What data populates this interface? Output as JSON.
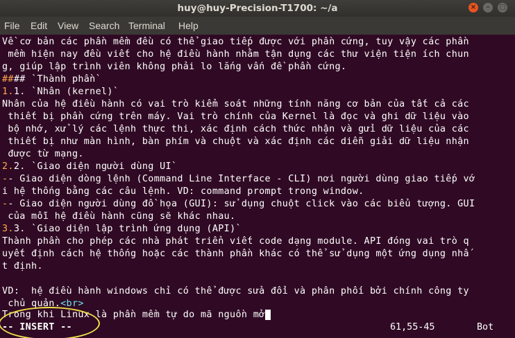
{
  "window": {
    "title": "huy@huy-Precision-T1700: ~/a",
    "close": "×",
    "minimize": "–",
    "maximize": "□"
  },
  "menu": [
    "File",
    "Edit",
    "View",
    "Search",
    "Terminal",
    "Help"
  ],
  "lines": [
    "Về cơ bản các phần mềm đều có thể giao tiếp được với phần cứng, tuy vậy các phần",
    " mềm hiện nay đều viết cho hệ điều hành nhằm tận dụng các thư viện tiện ích chun",
    "g, giúp lập trình viên không phải lo lắng vấn đề phần cứng.",
    "## `Thành phần`",
    "1. `Nhân (kernel)`",
    "Nhân của hệ điều hành có vai trò kiểm soát những tính năng cơ bản của tất cả các",
    " thiết bị phần cứng trên máy. Vai trò chính của Kernel là đọc và ghi dữ liệu vào",
    " bộ nhớ, xử lý các lệnh thực thi, xác định cách thức nhận và gửi dữ liệu của các",
    " thiết bị như màn hình, bàn phím và chuột và xác định các diễn giải dữ liệu nhận",
    " được từ mạng.",
    "2. `Giao diện người dùng UI`",
    "- Giao diện dòng lệnh (Command Line Interface - CLI) nơi người dùng giao tiếp vớ",
    "i hệ thống bằng các câu lệnh. VD: command prompt trong window.",
    "- Giao diện người dùng đồ họa (GUI): sử dụng chuột click vào các biểu tượng. GUI",
    " của mỗi hệ điều hành cũng sẽ khác nhau.",
    "3. `Giao diện lập trình ứng dụng (API)`",
    "Thành phần cho phép các nhà phát triển viết code dạng module. API đóng vai trò q",
    "uyết định cách hệ thống hoặc các thành phần khác có thể sử dụng một ứng dụng nhấ",
    "t định.",
    "",
    "VD:  hệ điều hành windows chỉ có thể được sửa đổi và phân phối bởi chính công ty",
    " chủ quản.",
    "Trong khi Linux là phần mềm tự do mã nguồn mở"
  ],
  "prefixes": {
    "h2": "##",
    "n1": "1.",
    "n2": "2.",
    "n3": "3.",
    "dash": "-"
  },
  "tag": "<br>",
  "status": {
    "mode": "-- INSERT --",
    "position": "61,55-45",
    "scroll": "Bot"
  }
}
